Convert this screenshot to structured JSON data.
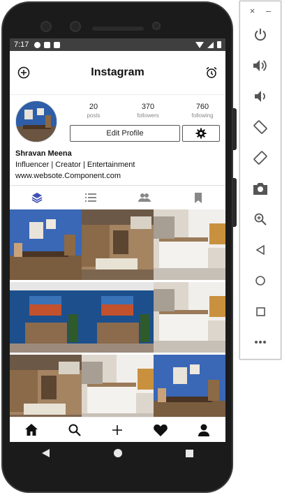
{
  "status_bar": {
    "time": "7:17"
  },
  "app": {
    "title": "Instagram"
  },
  "profile": {
    "stats": [
      {
        "value": "20",
        "label": "posts"
      },
      {
        "value": "370",
        "label": "followers"
      },
      {
        "value": "760",
        "label": "following"
      }
    ],
    "edit_label": "Edit Profile",
    "name": "Shravan Meena",
    "tagline": "Influencer | Creator | Entertainment",
    "website": "www.websote.Component.com"
  },
  "colors": {
    "accent": "#3f51b5",
    "status_bar": "#3f3f3f",
    "phone": "#1b1b1b"
  },
  "tabs": [
    "layers-icon",
    "list-icon",
    "people-icon",
    "bookmark-icon"
  ],
  "bottom_nav": [
    "home-icon",
    "search-icon",
    "add-icon",
    "heart-icon",
    "person-icon"
  ],
  "emulator_toolbar": {
    "window_controls": [
      "×",
      "–"
    ],
    "buttons": [
      "power-icon",
      "volume-up-icon",
      "volume-down-icon",
      "rotate-left-icon",
      "rotate-right-icon",
      "camera-icon",
      "zoom-icon",
      "back-icon",
      "home-icon",
      "overview-icon",
      "more-icon"
    ]
  }
}
